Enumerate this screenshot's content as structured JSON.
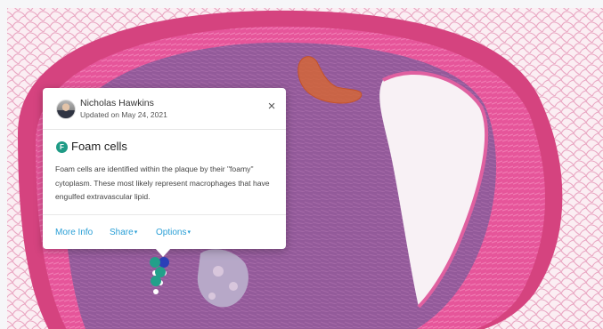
{
  "annotation": {
    "author": "Nicholas Hawkins",
    "updated": "Updated on May 24, 2021",
    "badge_letter": "F",
    "title": "Foam cells",
    "description": "Foam cells are identified within the plaque by their \"foamy\" cytoplasm. These most likely represent macrophages that have engulfed extravascular lipid.",
    "close_symbol": "×",
    "links": {
      "more_info": "More Info",
      "share": "Share",
      "options": "Options",
      "dropdown_caret": "▾"
    }
  },
  "colors": {
    "badge": "#1f9b86",
    "link": "#2a9fd6",
    "marker_primary": "#23a08a",
    "marker_secondary": "#2b3fb8",
    "region_highlight": "#d9662e"
  }
}
